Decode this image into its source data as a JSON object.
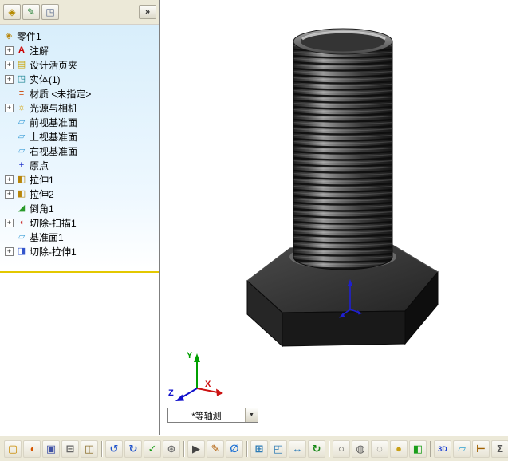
{
  "left_panel": {
    "tab_bar": {
      "tabs": [
        {
          "name": "featuremanager-tab",
          "glyph": "◈",
          "color": "#b58a00"
        },
        {
          "name": "propertymanager-tab",
          "glyph": "✎",
          "color": "#1a7a2a"
        },
        {
          "name": "configurationmanager-tab",
          "glyph": "◳",
          "color": "#5a6b8c"
        }
      ],
      "expand_button": "»"
    },
    "tree": {
      "root": {
        "label": "零件1",
        "icon": "part"
      },
      "items": [
        {
          "label": "注解",
          "icon": "annotations",
          "expandable": true
        },
        {
          "label": "设计活页夹",
          "icon": "design-binder",
          "expandable": true
        },
        {
          "label": "实体(1)",
          "icon": "solid-bodies",
          "expandable": true
        },
        {
          "label": "材质 <未指定>",
          "icon": "material",
          "expandable": false
        },
        {
          "label": "光源与相机",
          "icon": "lights-cameras",
          "expandable": true
        },
        {
          "label": "前视基准面",
          "icon": "plane",
          "expandable": false
        },
        {
          "label": "上视基准面",
          "icon": "plane",
          "expandable": false
        },
        {
          "label": "右视基准面",
          "icon": "plane",
          "expandable": false
        },
        {
          "label": "原点",
          "icon": "origin",
          "expandable": false
        },
        {
          "label": "拉伸1",
          "icon": "boss-extrude",
          "expandable": true
        },
        {
          "label": "拉伸2",
          "icon": "boss-extrude",
          "expandable": true
        },
        {
          "label": "倒角1",
          "icon": "chamfer",
          "expandable": false
        },
        {
          "label": "切除-扫描1",
          "icon": "cut-sweep",
          "expandable": true
        },
        {
          "label": "基准面1",
          "icon": "plane",
          "expandable": false
        },
        {
          "label": "切除-拉伸1",
          "icon": "cut-extrude",
          "expandable": true
        }
      ],
      "icon_glyphs": {
        "part": "◈",
        "annotations": "A",
        "design-binder": "▤",
        "solid-bodies": "◳",
        "material": "≡",
        "lights-cameras": "☼",
        "plane": "▱",
        "origin": "+",
        "boss-extrude": "◧",
        "chamfer": "◢",
        "cut-sweep": "◖",
        "cut-extrude": "◨"
      },
      "expander_glyph": "+"
    }
  },
  "viewport": {
    "model": "hex-bolt-shaded",
    "view_selector": {
      "value": "*等轴测",
      "arrow": "▼"
    },
    "triad": {
      "x": "X",
      "y": "Y",
      "z": "Z",
      "x_color": "#cc1111",
      "y_color": "#00a000",
      "z_color": "#1111cc"
    }
  },
  "toolbar": {
    "items": [
      {
        "name": "new-icon",
        "glyph": "▢",
        "color": "#c98a00"
      },
      {
        "name": "open-icon",
        "glyph": "◖",
        "color": "#d65400"
      },
      {
        "name": "save-icon",
        "glyph": "▣",
        "color": "#3f51a5"
      },
      {
        "name": "print-icon",
        "glyph": "⊟",
        "color": "#666666"
      },
      {
        "name": "print-preview-icon",
        "glyph": "◫",
        "color": "#8a6d2a"
      },
      {
        "sep": true
      },
      {
        "name": "undo-icon",
        "glyph": "↺",
        "color": "#2255cc"
      },
      {
        "name": "redo-icon",
        "glyph": "↻",
        "color": "#2255cc"
      },
      {
        "name": "rebuild-icon",
        "glyph": "✓",
        "color": "#1a9e1a"
      },
      {
        "name": "options-icon",
        "glyph": "⊛",
        "color": "#777777"
      },
      {
        "sep": true
      },
      {
        "name": "select-icon",
        "glyph": "▶",
        "color": "#444444"
      },
      {
        "name": "sketch-icon",
        "glyph": "✎",
        "color": "#b05a00"
      },
      {
        "name": "smart-dimension-icon",
        "glyph": "∅",
        "color": "#1a6fd4"
      },
      {
        "sep": true
      },
      {
        "name": "zoom-fit-icon",
        "glyph": "⊞",
        "color": "#2a7ab5"
      },
      {
        "name": "zoom-area-icon",
        "glyph": "◰",
        "color": "#2a7ab5"
      },
      {
        "name": "pan-icon",
        "glyph": "↔",
        "color": "#2a7ab5"
      },
      {
        "name": "rotate-view-icon",
        "glyph": "↻",
        "color": "#188a18"
      },
      {
        "sep": true
      },
      {
        "name": "wireframe-icon",
        "glyph": "○",
        "color": "#555555"
      },
      {
        "name": "hidden-lines-visible-icon",
        "glyph": "◍",
        "color": "#555555"
      },
      {
        "name": "hidden-lines-removed-icon",
        "glyph": "◌",
        "color": "#555555"
      },
      {
        "name": "shaded-icon",
        "glyph": "●",
        "color": "#c9a017"
      },
      {
        "name": "section-view-icon",
        "glyph": "◧",
        "color": "#1a9e1a"
      },
      {
        "sep": true
      },
      {
        "name": "3d-sketch-icon",
        "glyph": "3D",
        "color": "#1a3fd4"
      },
      {
        "name": "reference-plane-icon",
        "glyph": "▱",
        "color": "#30a0d0"
      },
      {
        "name": "measure-icon",
        "glyph": "⊢",
        "color": "#a06000"
      },
      {
        "name": "mass-properties-icon",
        "glyph": "Σ",
        "color": "#555555"
      },
      {
        "sep": true
      },
      {
        "name": "help-icon",
        "glyph": "?",
        "color": "#2255cc"
      }
    ]
  },
  "colors": {
    "panel_bg_top": "#d8eefb",
    "toolbar_bg": "#ece9d8",
    "rollback_bar": "#e3c800",
    "bolt_dark": "#1a1a1a",
    "bolt_highlight": "#b9b9b9",
    "origin_marker": "#2020d0"
  }
}
